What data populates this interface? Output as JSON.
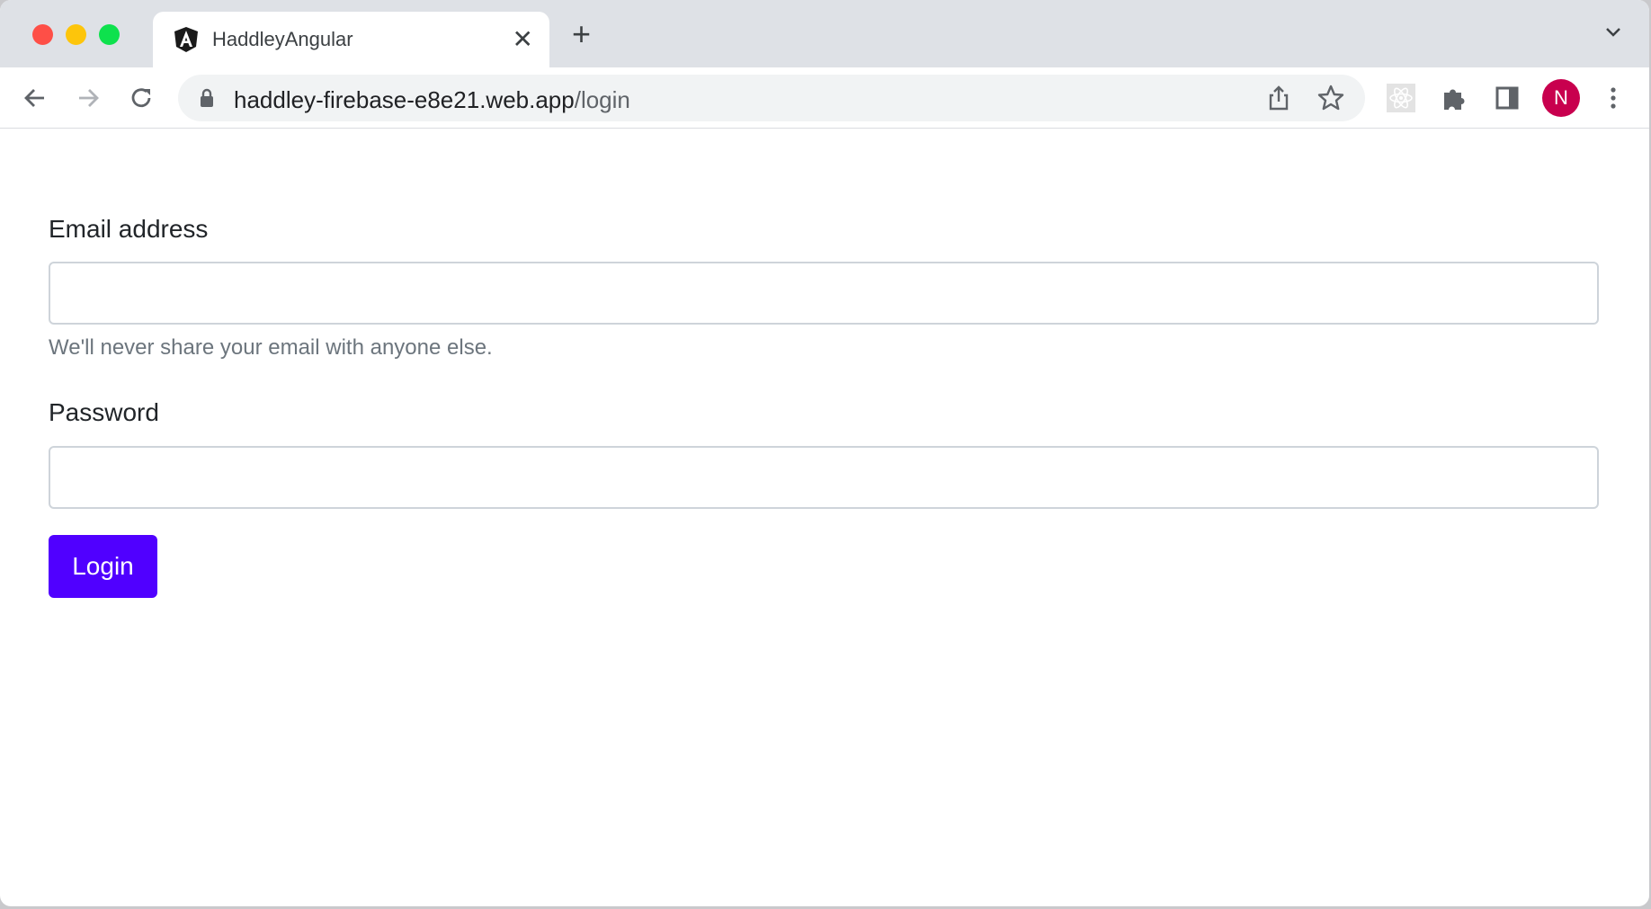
{
  "browser": {
    "tab_title": "HaddleyAngular",
    "url_host": "haddley-firebase-e8e21.web.app",
    "url_path": "/login",
    "profile_initial": "N",
    "colors": {
      "profile": "#c8004e",
      "close": "#ff5f57",
      "minimize": "#febc2e",
      "maximize": "#28c840"
    }
  },
  "form": {
    "email_label": "Email address",
    "email_value": "",
    "email_help": "We'll never share your email with anyone else.",
    "password_label": "Password",
    "password_value": "",
    "login_label": "Login",
    "accent": "#5000ff"
  }
}
